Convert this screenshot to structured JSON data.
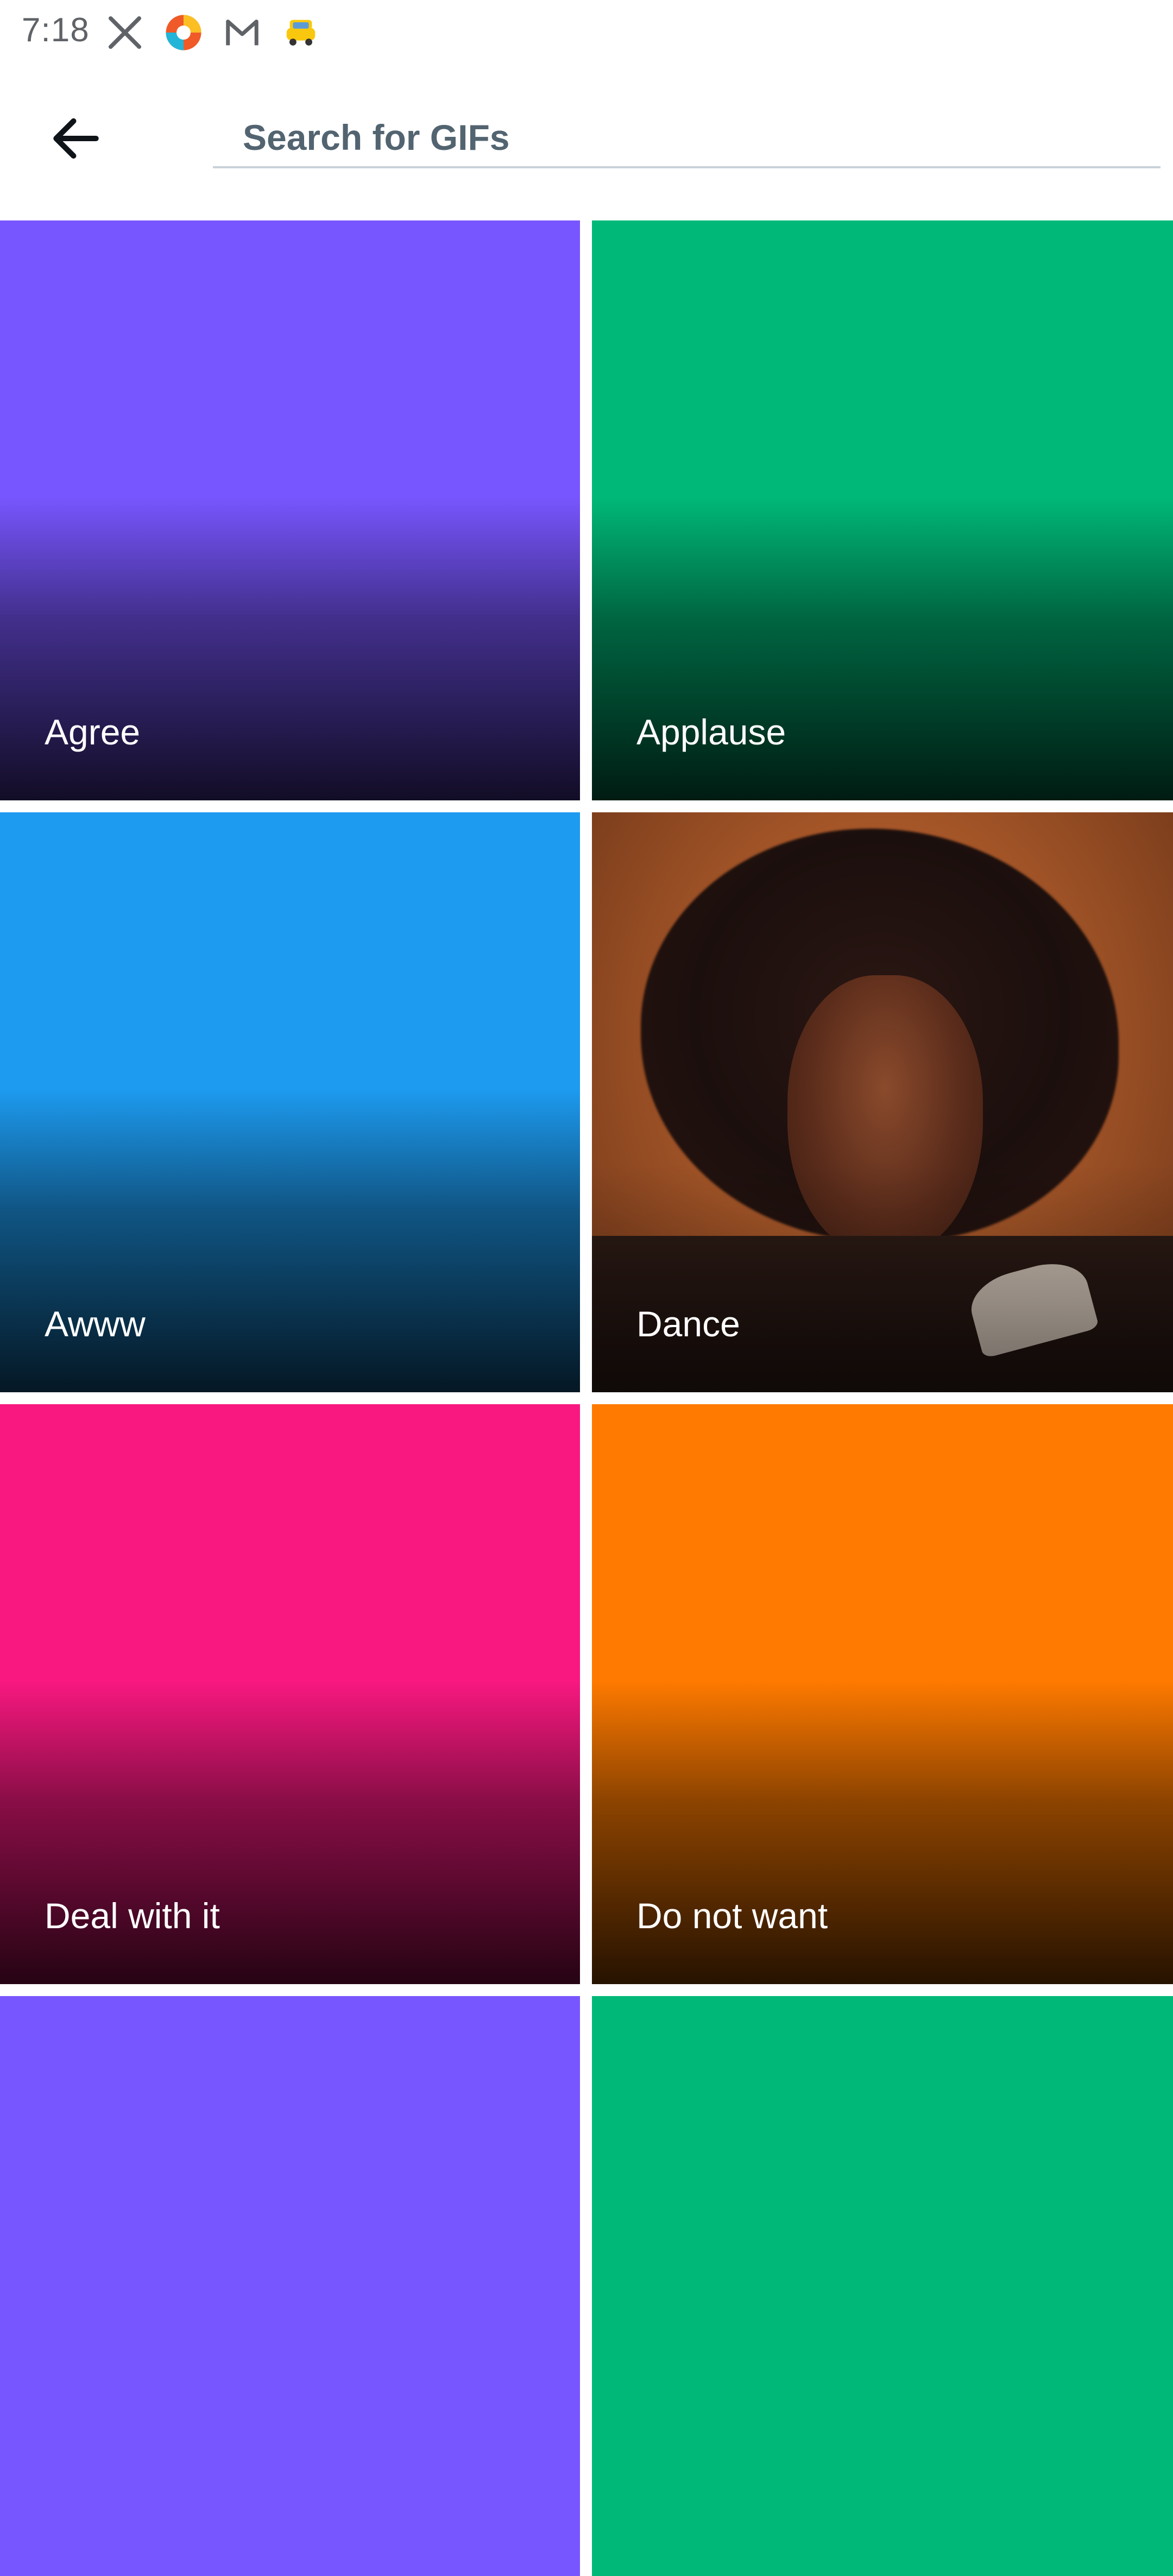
{
  "status_bar": {
    "time": "7:18",
    "icons": [
      "x-app-icon",
      "browser-icon",
      "mail-icon",
      "taxi-icon"
    ]
  },
  "header": {
    "back_icon": "arrow-left-icon",
    "search_placeholder": "Search for GIFs"
  },
  "categories": [
    {
      "label": "Agree",
      "color": "#7856ff"
    },
    {
      "label": "Applause",
      "color": "#00b978"
    },
    {
      "label": "Awww",
      "color": "#1d9bf0"
    },
    {
      "label": "Dance",
      "color": "photo"
    },
    {
      "label": "Deal with it",
      "color": "#f91880"
    },
    {
      "label": "Do not want",
      "color": "#ff7a00"
    },
    {
      "label": "",
      "color": "#7856ff"
    },
    {
      "label": "",
      "color": "#00b978"
    }
  ]
}
